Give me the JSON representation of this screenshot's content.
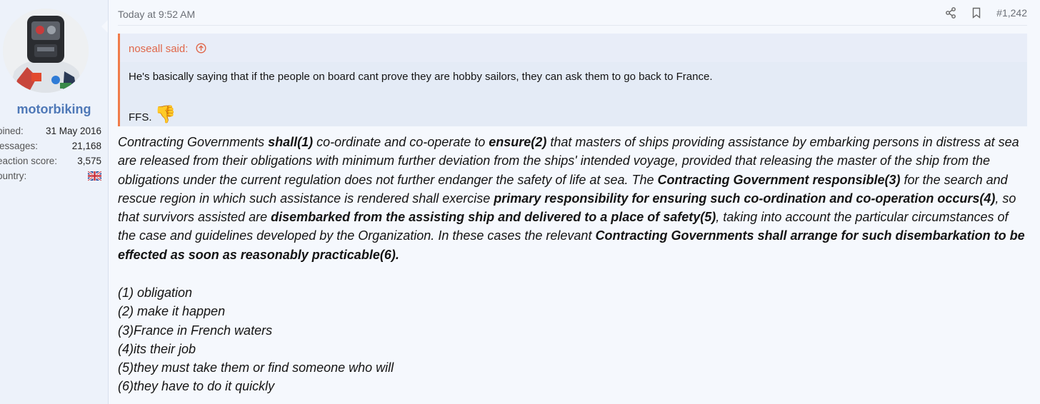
{
  "user": {
    "username": "motorbiking",
    "stats": [
      {
        "label": "oined:",
        "value": "31 May 2016"
      },
      {
        "label": "lessages:",
        "value": "21,168"
      },
      {
        "label": "eaction score:",
        "value": "3,575"
      },
      {
        "label": "ountry:",
        "value": ""
      }
    ],
    "country_flag_icon": "uk-flag-icon"
  },
  "post": {
    "date": "Today at 9:52 AM",
    "post_number": "#1,242",
    "icons": {
      "share": "share-icon",
      "bookmark": "bookmark-icon"
    }
  },
  "quote": {
    "author": "noseall said:",
    "line1": "He's basically saying that if the people on board cant prove they are hobby sailors, they can ask them to go back to France.",
    "ffs": "FFS.",
    "emoji": "👎"
  },
  "body": {
    "p1": "Contracting Governments ",
    "b1": "shall(1)",
    "p2": " co-ordinate and co-operate to ",
    "b2": "ensure(2)",
    "p3": " that masters of ships providing assistance by embarking persons in distress at sea are released from their obligations with minimum further deviation from the ships' intended voyage, provided that releasing the master of the ship from the obligations under the current regulation does not further endanger the safety of life at sea. The ",
    "b3": "Contracting Government responsible(3)",
    "p4": " for the search and rescue region in which such assistance is rendered shall exercise ",
    "b4": "primary responsibility for ensuring such co-ordination and co-operation occurs(4)",
    "p5": ", so that survivors assisted are ",
    "b5": "disembarked from the assisting ship and delivered to a place of safety(5)",
    "p6": ", taking into account the particular circumstances of the case and guidelines developed by the Organization. In these cases the relevant ",
    "b6": "Contracting Governments shall arrange for such disembarkation to be effected as soon as reasonably practicable(6)."
  },
  "list": [
    "(1) obligation",
    "(2) make it happen",
    "(3)France in French waters",
    "(4)its their job",
    "(5)they must take them or find someone who will",
    "(6)they have to do it quickly"
  ]
}
